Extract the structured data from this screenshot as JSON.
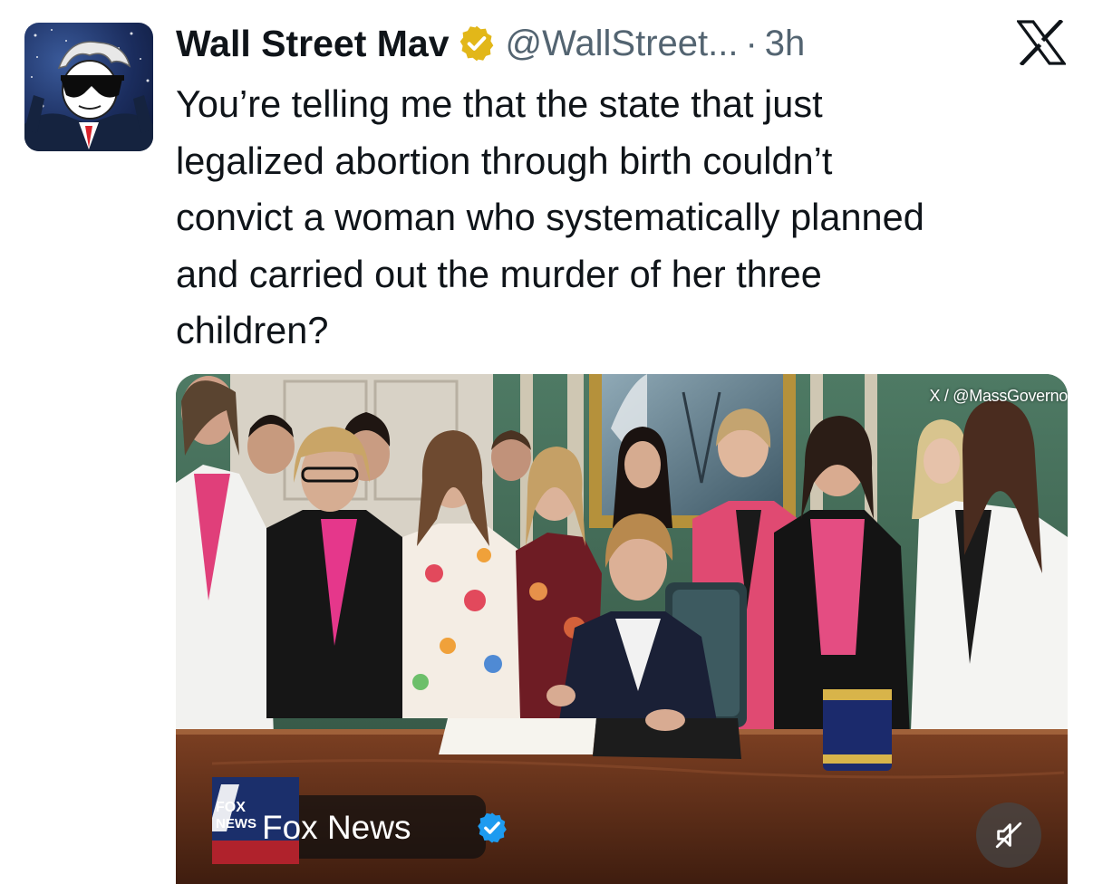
{
  "tweet": {
    "author": {
      "display_name": "Wall Street Mav",
      "handle": "@WallStreet...",
      "verified": "gold",
      "avatar_icon": "sunglasses-cartoon-avatar"
    },
    "separator": "·",
    "time": "3h",
    "platform_icon": "x-logo-icon",
    "text": "You’re telling me that the state that just\nlegalized abortion through birth couldn’t\nconvict a woman who systematically planned\nand carried out the murder of her three\nchildren?",
    "media": {
      "credit": "X / @MassGoverno",
      "source": {
        "name": "Fox News",
        "logo_lines": [
          "FOX",
          "NEWS"
        ],
        "verified": "blue"
      },
      "mute_icon": "speaker-muted-icon"
    }
  },
  "colors": {
    "text": "#0f1419",
    "secondary": "#536471",
    "gold_badge": "#e2b719",
    "blue_badge": "#1d9bf0"
  }
}
